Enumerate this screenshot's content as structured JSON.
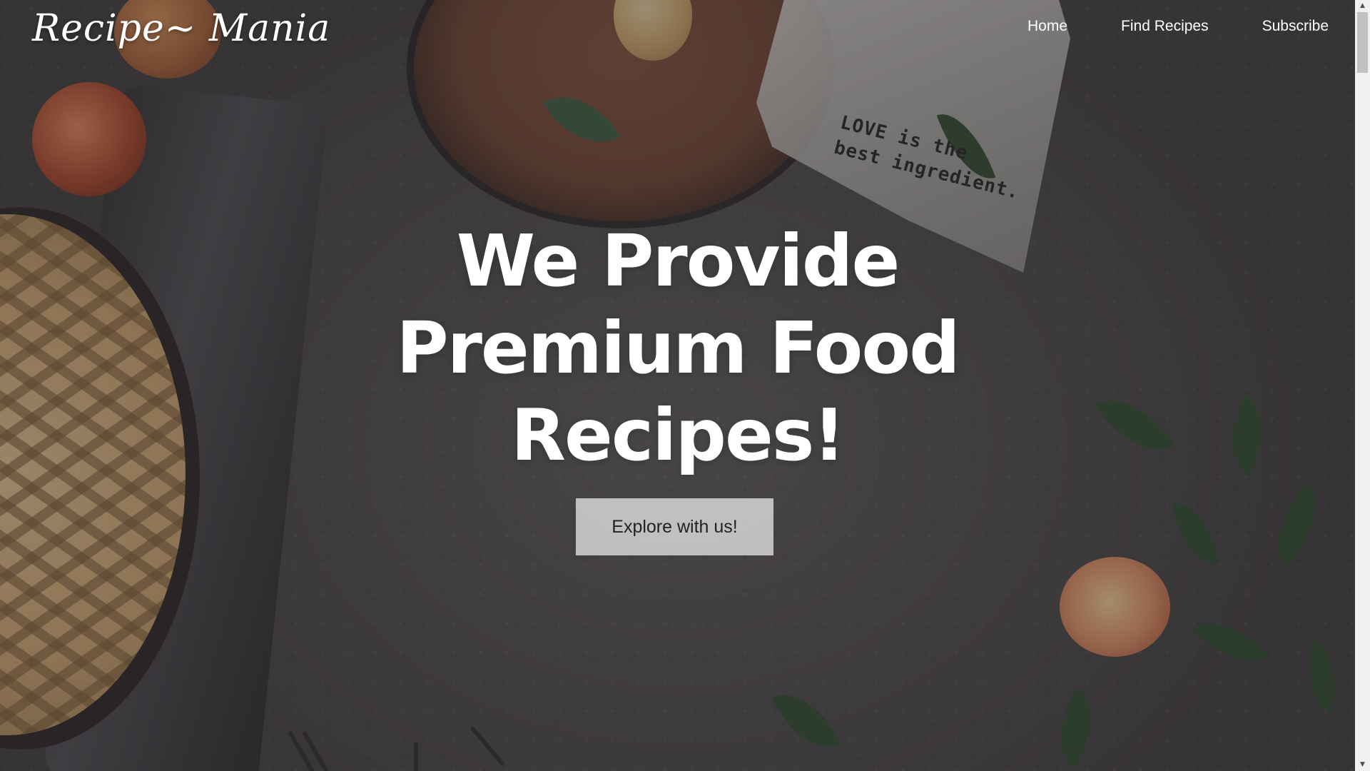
{
  "header": {
    "logo_text": "Recipe~ Mania",
    "nav": [
      {
        "label": "Home"
      },
      {
        "label": "Find Recipes"
      },
      {
        "label": "Subscribe"
      }
    ]
  },
  "hero": {
    "heading": "We Provide Premium Food Recipes!",
    "cta_label": "Explore with us!"
  },
  "background": {
    "napkin_text": "LOVE is the\nbest ingredient."
  },
  "scrollbar": {
    "up_arrow": "▲",
    "down_arrow": "▼"
  }
}
